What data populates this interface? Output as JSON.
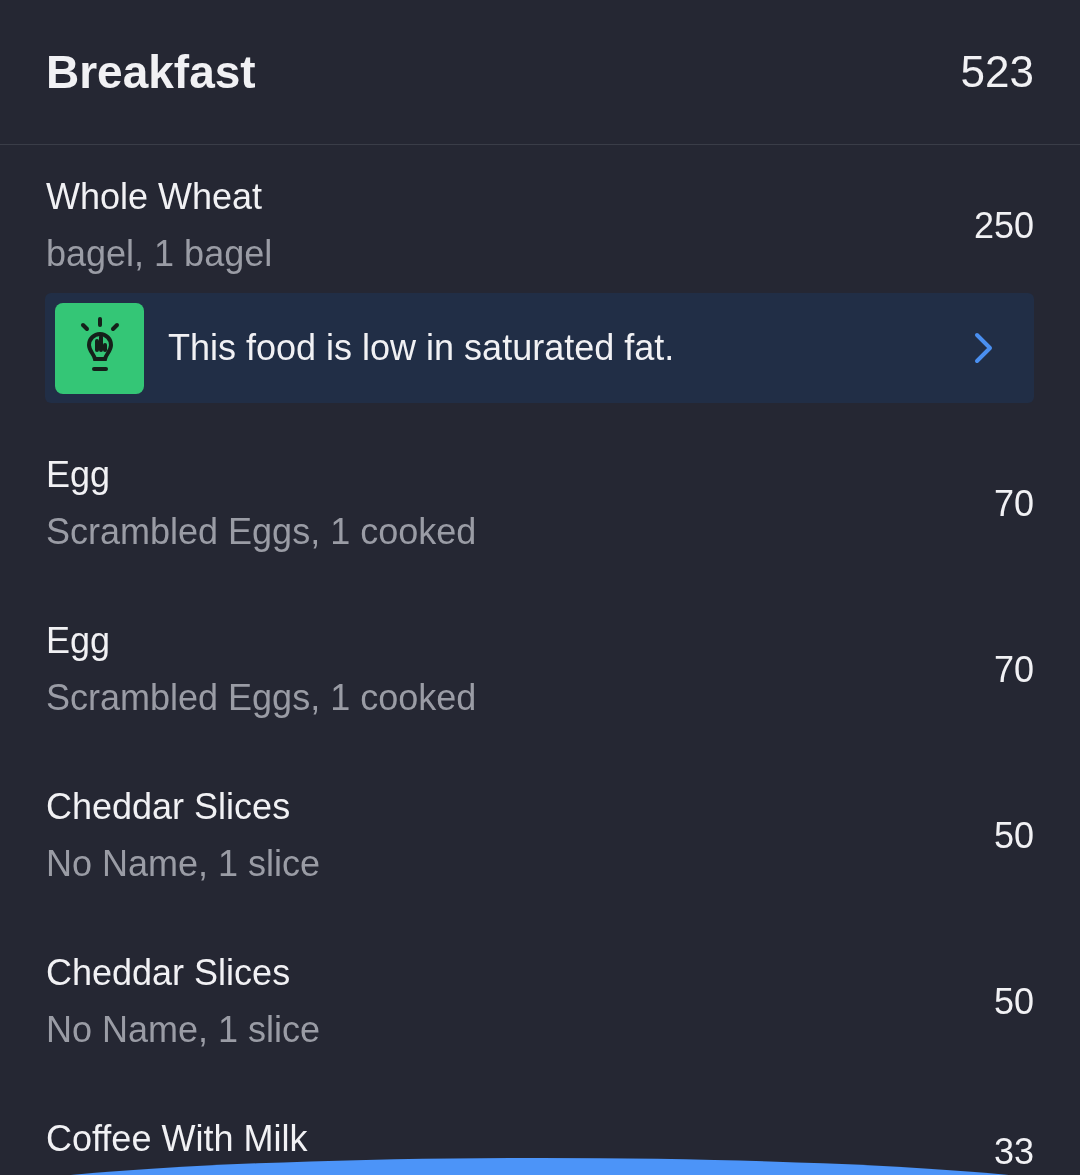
{
  "meal": {
    "title": "Breakfast",
    "calories": "523"
  },
  "foods": [
    {
      "name": "Whole Wheat",
      "detail": "bagel, 1 bagel",
      "calories": "250",
      "tip": {
        "text": "This food is low in saturated fat."
      }
    },
    {
      "name": "Egg",
      "detail": "Scrambled Eggs, 1 cooked",
      "calories": "70"
    },
    {
      "name": "Egg",
      "detail": "Scrambled Eggs, 1 cooked",
      "calories": "70"
    },
    {
      "name": "Cheddar Slices",
      "detail": "No Name, 1 slice",
      "calories": "50"
    },
    {
      "name": "Cheddar Slices",
      "detail": "No Name, 1 slice",
      "calories": "50"
    },
    {
      "name": "Coffee With Milk",
      "calories": "33"
    }
  ]
}
